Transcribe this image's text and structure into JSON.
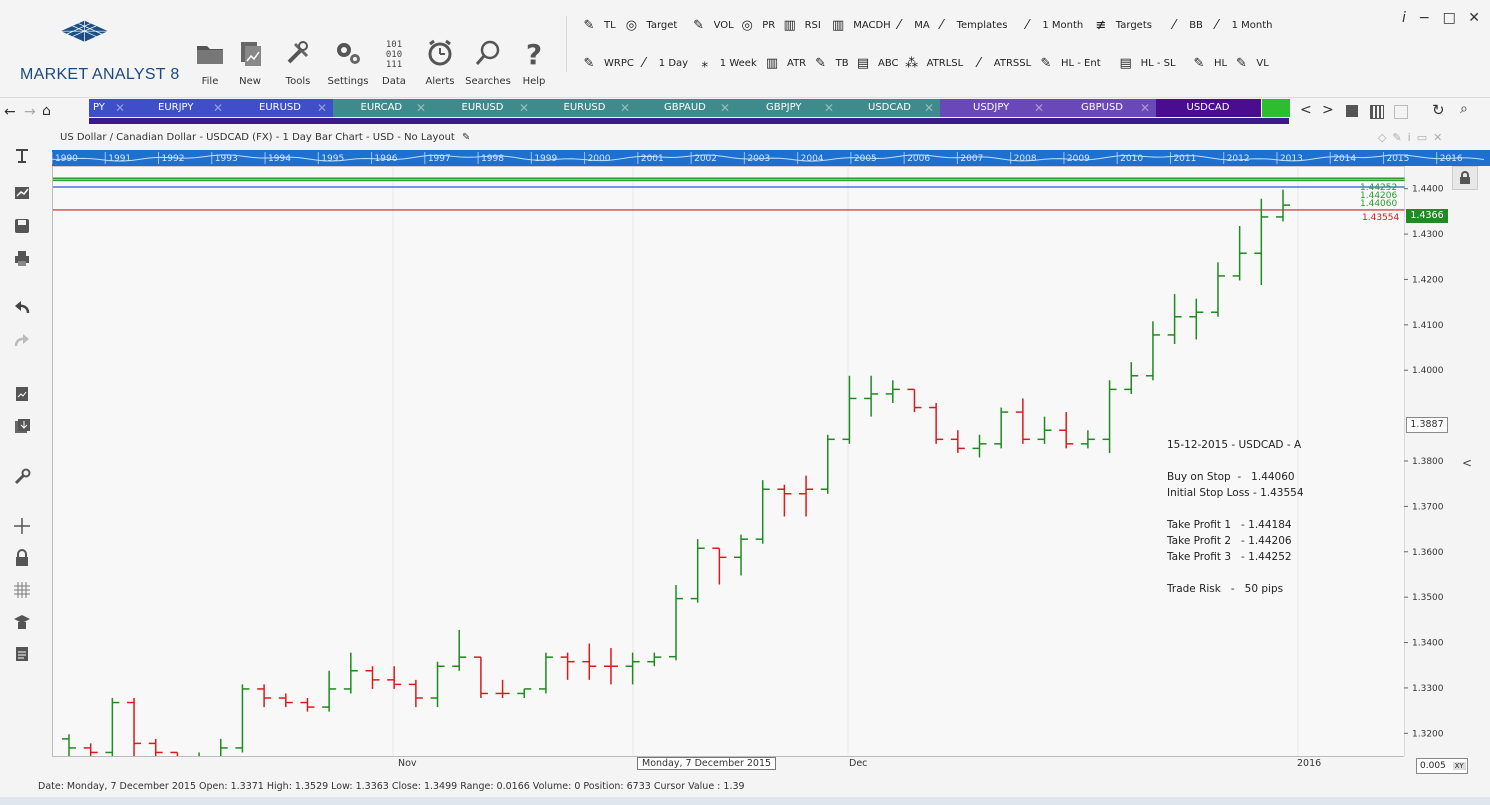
{
  "app": {
    "logo_text": "MARKET ANALYST 8",
    "menu": [
      {
        "label": "File",
        "icon": "folder-icon"
      },
      {
        "label": "New",
        "icon": "new-document-icon"
      },
      {
        "label": "Tools",
        "icon": "tools-icon"
      },
      {
        "label": "Settings",
        "icon": "gears-icon"
      },
      {
        "label": "Data",
        "icon": "binary-data-icon"
      },
      {
        "label": "Alerts",
        "icon": "alarm-clock-icon"
      },
      {
        "label": "Searches",
        "icon": "magnifier-icon"
      },
      {
        "label": "Help",
        "icon": "question-icon"
      }
    ],
    "toolbar_row1": [
      "TL",
      "Target",
      "VOL",
      "PR",
      "RSI",
      "MACDH",
      "MA",
      "Templates",
      "1 Month",
      "Targets",
      "BB",
      "1 Month"
    ],
    "toolbar_row2": [
      "WRPC",
      "1 Day",
      "1 Week",
      "ATR",
      "TB",
      "ABC",
      "ATRLSL",
      "ATRSSL",
      "HL - Ent",
      "HL - SL",
      "HL",
      "VL"
    ],
    "window_controls": [
      "i",
      "−",
      "□",
      "✕"
    ]
  },
  "tabs": [
    {
      "label": "PY",
      "color": "#3e4fc8"
    },
    {
      "label": "EURJPY",
      "color": "#3e4fc8"
    },
    {
      "label": "EURUSD",
      "color": "#3e4fc8"
    },
    {
      "label": "EURCAD",
      "color": "#3f8a8a"
    },
    {
      "label": "EURUSD",
      "color": "#3f8a8a"
    },
    {
      "label": "EURUSD",
      "color": "#3f8a8a"
    },
    {
      "label": "GBPAUD",
      "color": "#3f8a8a"
    },
    {
      "label": "GBPJPY",
      "color": "#3f8a8a"
    },
    {
      "label": "USDCAD",
      "color": "#3f8a8a"
    },
    {
      "label": "USDJPY",
      "color": "#6a48b8"
    },
    {
      "label": "GBPUSD",
      "color": "#6a48b8"
    },
    {
      "label": "USDCAD",
      "color": "#4a0d8f"
    }
  ],
  "chart_title": "US Dollar / Canadian Dollar - USDCAD (FX) - 1 Day Bar Chart - USD - No Layout",
  "timeline_years": [
    "1990",
    "1991",
    "1992",
    "1993",
    "1994",
    "1995",
    "1996",
    "1997",
    "1998",
    "1999",
    "2000",
    "2001",
    "2002",
    "2003",
    "2004",
    "2005",
    "2006",
    "2007",
    "2008",
    "2009",
    "2010",
    "2011",
    "2012",
    "2013",
    "2014",
    "2015",
    "2016"
  ],
  "x_labels": [
    "Nov",
    "Monday, 7 December 2015",
    "Dec",
    "2016"
  ],
  "y_ticks": [
    "1.4400",
    "1.4300",
    "1.4200",
    "1.4100",
    "1.4000",
    "1.3800",
    "1.3700",
    "1.3600",
    "1.3500",
    "1.3400",
    "1.3300",
    "1.3200"
  ],
  "price_labels": {
    "current": "1.4366",
    "cursor": "1.3887",
    "stop": "1.43555",
    "targets_top": [
      "1.44252",
      "1.44206",
      "1.44060"
    ],
    "stop_label": "1.43554",
    "step": "0.005"
  },
  "trade_note": [
    "15-12-2015 - USDCAD - A",
    "",
    "Buy on Stop  -   1.44060",
    "Initial Stop Loss - 1.43554",
    "",
    "Take Profit 1   - 1.44184",
    "Take Profit 2   - 1.44206",
    "Take Profit 3   - 1.44252",
    "",
    "Trade Risk   -   50 pips"
  ],
  "status_text": "Date: Monday, 7 December 2015 Open: 1.3371 High: 1.3529 Low: 1.3363 Close: 1.3499 Range: 0.0166 Volume: 0 Position: 6733 Cursor Value : 1.39",
  "chart_data": {
    "type": "ohlc-bar",
    "title": "US Dollar / Canadian Dollar - USDCAD (FX) - 1 Day Bar Chart - USD - No Layout",
    "ylim": [
      1.315,
      1.445
    ],
    "hlines": [
      {
        "value": 1.44252,
        "color": "#2e9a2e"
      },
      {
        "value": 1.44206,
        "color": "#2e9a2e"
      },
      {
        "value": 1.4406,
        "color": "#2b5bd8"
      },
      {
        "value": 1.43554,
        "color": "#d02020"
      }
    ],
    "bars": [
      [
        1.319,
        1.32,
        1.315,
        1.317,
        "g"
      ],
      [
        1.317,
        1.318,
        1.315,
        1.316,
        "r"
      ],
      [
        1.316,
        1.328,
        1.315,
        1.327,
        "g"
      ],
      [
        1.327,
        1.328,
        1.315,
        1.318,
        "r"
      ],
      [
        1.318,
        1.319,
        1.314,
        1.316,
        "r"
      ],
      [
        1.316,
        1.316,
        1.31,
        1.311,
        "r"
      ],
      [
        1.311,
        1.316,
        1.307,
        1.315,
        "g"
      ],
      [
        1.315,
        1.319,
        1.312,
        1.317,
        "g"
      ],
      [
        1.317,
        1.331,
        1.316,
        1.33,
        "g"
      ],
      [
        1.33,
        1.331,
        1.326,
        1.328,
        "r"
      ],
      [
        1.328,
        1.329,
        1.326,
        1.327,
        "r"
      ],
      [
        1.327,
        1.328,
        1.325,
        1.326,
        "r"
      ],
      [
        1.326,
        1.334,
        1.325,
        1.33,
        "g"
      ],
      [
        1.33,
        1.338,
        1.329,
        1.334,
        "g"
      ],
      [
        1.334,
        1.335,
        1.33,
        1.332,
        "r"
      ],
      [
        1.332,
        1.335,
        1.33,
        1.331,
        "r"
      ],
      [
        1.331,
        1.332,
        1.326,
        1.328,
        "r"
      ],
      [
        1.328,
        1.336,
        1.326,
        1.335,
        "g"
      ],
      [
        1.335,
        1.343,
        1.334,
        1.337,
        "g"
      ],
      [
        1.337,
        1.337,
        1.328,
        1.329,
        "r"
      ],
      [
        1.329,
        1.332,
        1.328,
        1.329,
        "r"
      ],
      [
        1.329,
        1.33,
        1.328,
        1.33,
        "g"
      ],
      [
        1.33,
        1.338,
        1.329,
        1.337,
        "g"
      ],
      [
        1.337,
        1.338,
        1.332,
        1.336,
        "r"
      ],
      [
        1.336,
        1.34,
        1.332,
        1.335,
        "r"
      ],
      [
        1.335,
        1.339,
        1.331,
        1.335,
        "r"
      ],
      [
        1.335,
        1.338,
        1.331,
        1.336,
        "g"
      ],
      [
        1.336,
        1.338,
        1.335,
        1.337,
        "g"
      ],
      [
        1.3371,
        1.3529,
        1.3363,
        1.3499,
        "g"
      ],
      [
        1.3499,
        1.363,
        1.349,
        1.361,
        "g"
      ],
      [
        1.361,
        1.361,
        1.353,
        1.359,
        "r"
      ],
      [
        1.359,
        1.364,
        1.355,
        1.363,
        "g"
      ],
      [
        1.363,
        1.376,
        1.362,
        1.374,
        "g"
      ],
      [
        1.374,
        1.375,
        1.368,
        1.373,
        "r"
      ],
      [
        1.373,
        1.377,
        1.368,
        1.374,
        "r"
      ],
      [
        1.374,
        1.386,
        1.373,
        1.385,
        "g"
      ],
      [
        1.385,
        1.399,
        1.384,
        1.394,
        "g"
      ],
      [
        1.394,
        1.399,
        1.39,
        1.395,
        "g"
      ],
      [
        1.395,
        1.398,
        1.393,
        1.396,
        "g"
      ],
      [
        1.396,
        1.396,
        1.391,
        1.392,
        "r"
      ],
      [
        1.392,
        1.393,
        1.384,
        1.385,
        "r"
      ],
      [
        1.385,
        1.387,
        1.382,
        1.383,
        "r"
      ],
      [
        1.383,
        1.386,
        1.381,
        1.384,
        "g"
      ],
      [
        1.384,
        1.392,
        1.383,
        1.391,
        "g"
      ],
      [
        1.391,
        1.394,
        1.384,
        1.385,
        "r"
      ],
      [
        1.385,
        1.39,
        1.384,
        1.387,
        "g"
      ],
      [
        1.387,
        1.391,
        1.383,
        1.384,
        "r"
      ],
      [
        1.384,
        1.387,
        1.383,
        1.385,
        "g"
      ],
      [
        1.385,
        1.398,
        1.382,
        1.396,
        "g"
      ],
      [
        1.396,
        1.402,
        1.395,
        1.399,
        "g"
      ],
      [
        1.399,
        1.411,
        1.398,
        1.408,
        "g"
      ],
      [
        1.408,
        1.417,
        1.406,
        1.412,
        "g"
      ],
      [
        1.412,
        1.416,
        1.407,
        1.413,
        "g"
      ],
      [
        1.413,
        1.424,
        1.412,
        1.421,
        "g"
      ],
      [
        1.421,
        1.432,
        1.42,
        1.426,
        "g"
      ],
      [
        1.426,
        1.438,
        1.419,
        1.434,
        "g"
      ],
      [
        1.434,
        1.44,
        1.433,
        1.4366,
        "g"
      ]
    ]
  }
}
